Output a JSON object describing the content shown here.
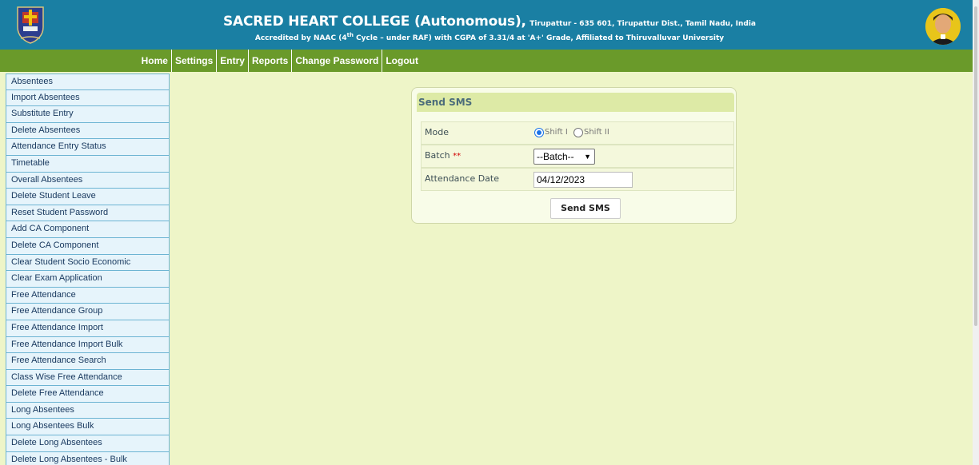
{
  "header": {
    "title_main": "SACRED HEART COLLEGE (Autonomous),",
    "title_location": "Tirupattur - 635 601, Tirupattur Dist., Tamil Nadu, India",
    "subtitle_prefix": "Accredited by NAAC (4",
    "subtitle_sup": "th",
    "subtitle_suffix": " Cycle – under RAF) with CGPA of 3.31/4 at 'A+' Grade, Affiliated to Thiruvalluvar University"
  },
  "nav": {
    "items": [
      "Home",
      "Settings",
      "Entry",
      "Reports",
      "Change Password",
      "Logout"
    ]
  },
  "sidebar": {
    "items": [
      "Absentees",
      "Import Absentees",
      "Substitute Entry",
      "Delete Absentees",
      "Attendance Entry Status",
      "Timetable",
      "Overall Absentees",
      "Delete Student Leave",
      "Reset Student Password",
      "Add CA Component",
      "Delete CA Component",
      "Clear Student Socio Economic",
      "Clear Exam Application",
      "Free Attendance",
      "Free Attendance Group",
      "Free Attendance Import",
      "Free Attendance Import Bulk",
      "Free Attendance Search",
      "Class Wise Free Attendance",
      "Delete Free Attendance",
      "Long Absentees",
      "Long Absentees Bulk",
      "Delete Long Absentees",
      "Delete Long Absentees - Bulk"
    ]
  },
  "form": {
    "title": "Send SMS",
    "mode_label": "Mode",
    "mode_options": [
      "Shift I",
      "Shift II"
    ],
    "mode_selected": "Shift I",
    "batch_label": "Batch",
    "batch_required": "**",
    "batch_value": "--Batch--",
    "date_label": "Attendance Date",
    "date_value": "04/12/2023",
    "submit_label": "Send SMS"
  },
  "colors": {
    "header_bg": "#1a7fa3",
    "nav_bg": "#6a9a2a",
    "page_bg": "#eef5c8",
    "sidebar_bg": "#e6f4fb"
  }
}
